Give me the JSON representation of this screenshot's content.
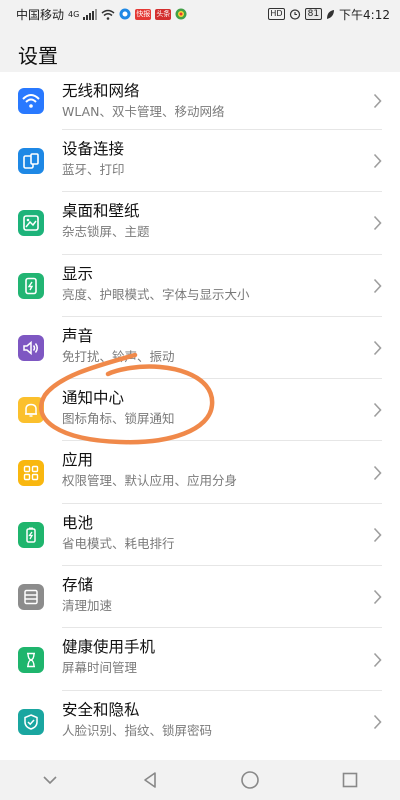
{
  "status_bar": {
    "carrier": "中国移动",
    "network": "4G",
    "app_badges": [
      {
        "label": "快报",
        "color": "#e53935"
      },
      {
        "label": "头条",
        "color": "#d32f2f"
      }
    ],
    "hd": "HD",
    "battery": "81",
    "time": "下午4:12"
  },
  "page": {
    "title": "设置"
  },
  "settings": [
    {
      "title": "无线和网络",
      "subtitle": "WLAN、双卡管理、移动网络",
      "icon": "wifi-icon",
      "color": "#2979ff"
    },
    {
      "title": "设备连接",
      "subtitle": "蓝牙、打印",
      "icon": "device-connection-icon",
      "color": "#1e88e5"
    },
    {
      "title": "桌面和壁纸",
      "subtitle": "杂志锁屏、主题",
      "icon": "wallpaper-icon",
      "color": "#1db37a"
    },
    {
      "title": "显示",
      "subtitle": "亮度、护眼模式、字体与显示大小",
      "icon": "display-icon",
      "color": "#22b573"
    },
    {
      "title": "声音",
      "subtitle": "免打扰、铃声、振动",
      "icon": "sound-icon",
      "color": "#7e57c2"
    },
    {
      "title": "通知中心",
      "subtitle": "图标角标、锁屏通知",
      "icon": "notification-bell-icon",
      "color": "#fbc02d"
    },
    {
      "title": "应用",
      "subtitle": "权限管理、默认应用、应用分身",
      "icon": "apps-grid-icon",
      "color": "#f9b70f"
    },
    {
      "title": "电池",
      "subtitle": "省电模式、耗电排行",
      "icon": "battery-icon",
      "color": "#1fb56d"
    },
    {
      "title": "存储",
      "subtitle": "清理加速",
      "icon": "storage-icon",
      "color": "#8c8c8c"
    },
    {
      "title": "健康使用手机",
      "subtitle": "屏幕时间管理",
      "icon": "hourglass-icon",
      "color": "#1fb56d"
    },
    {
      "title": "安全和隐私",
      "subtitle": "人脸识别、指纹、锁屏密码",
      "icon": "shield-check-icon",
      "color": "#1aa6a0"
    }
  ],
  "nav_bar": {
    "buttons": [
      "collapse-icon",
      "back-icon",
      "home-icon",
      "recents-icon"
    ]
  },
  "annotation_color": "#f0894a"
}
